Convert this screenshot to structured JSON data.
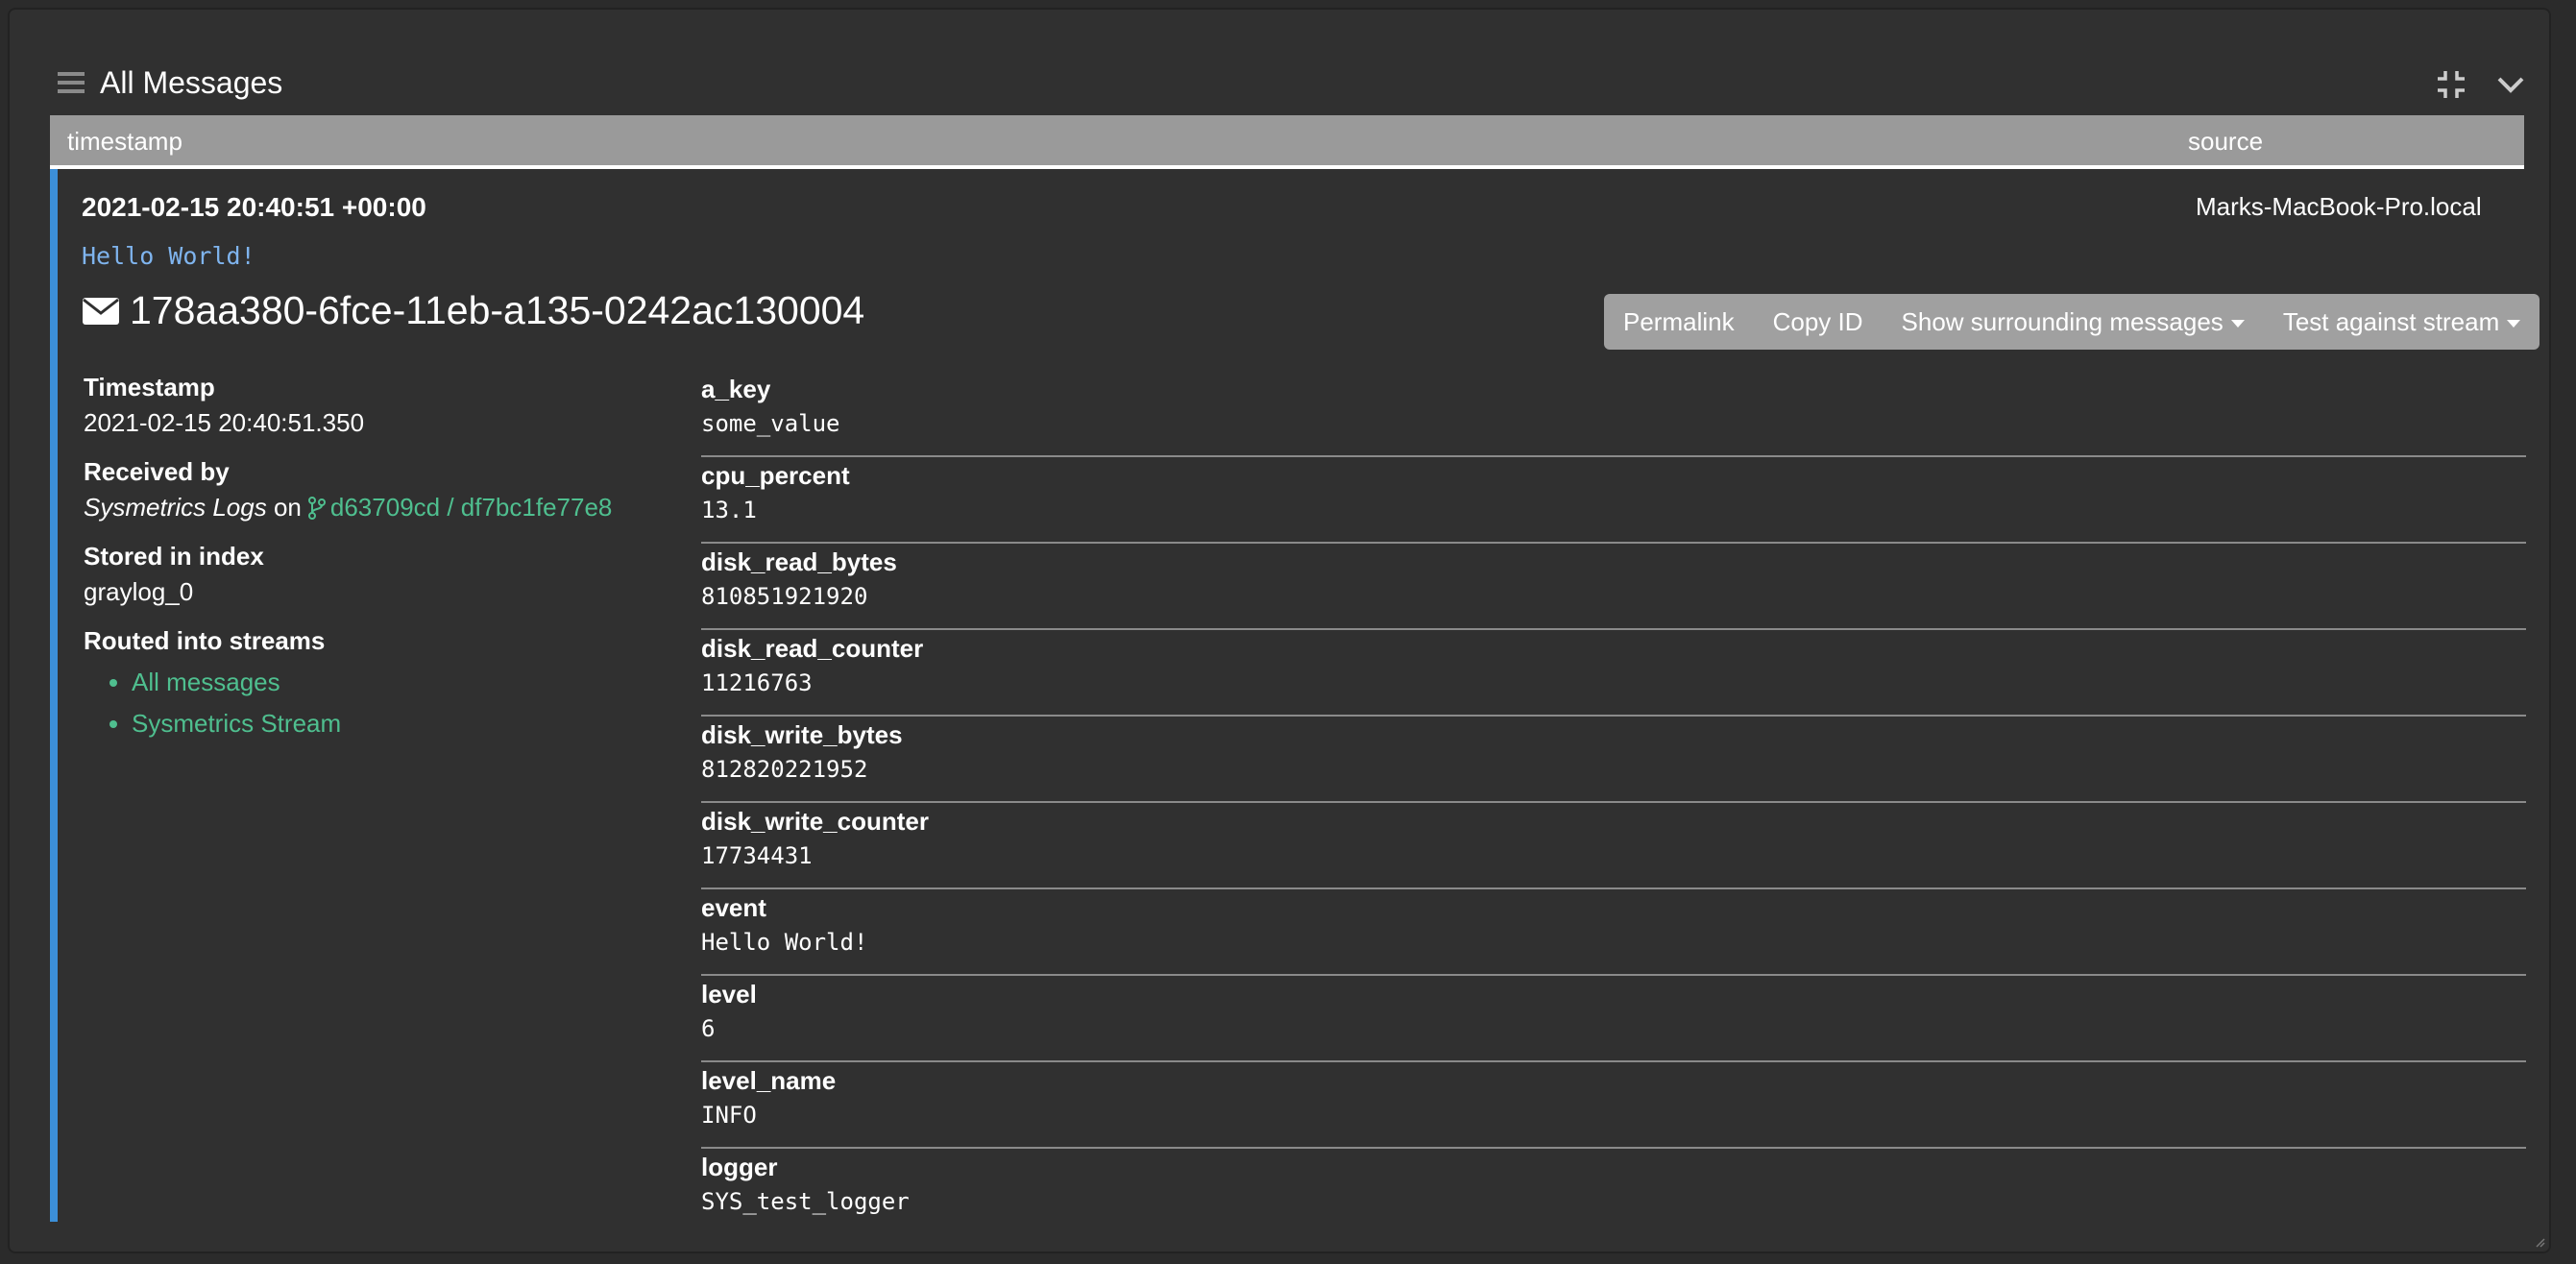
{
  "widget": {
    "title": "All Messages",
    "icons": [
      "drag-handle-icon",
      "minimize-icon",
      "chevron-down-icon"
    ]
  },
  "table": {
    "columns": [
      "timestamp",
      "source"
    ]
  },
  "message": {
    "timestamp": "2021-02-15 20:40:51 +00:00",
    "source": "Marks-MacBook-Pro.local",
    "text": "Hello World!",
    "id": "178aa380-6fce-11eb-a135-0242ac130004",
    "actions": {
      "permalink": "Permalink",
      "copy_id": "Copy ID",
      "surrounding": "Show surrounding messages",
      "test_stream": "Test against stream"
    },
    "meta": {
      "timestamp_label": "Timestamp",
      "timestamp_value": "2021-02-15 20:40:51.350",
      "received_label": "Received by",
      "received_input": "Sysmetrics Logs",
      "received_on": "on",
      "received_node": "d63709cd / df7bc1fe77e8",
      "index_label": "Stored in index",
      "index_value": "graylog_0",
      "streams_label": "Routed into streams",
      "streams": [
        "All messages",
        "Sysmetrics Stream"
      ]
    },
    "fields": [
      {
        "name": "a_key",
        "value": "some_value"
      },
      {
        "name": "cpu_percent",
        "value": "13.1"
      },
      {
        "name": "disk_read_bytes",
        "value": "810851921920"
      },
      {
        "name": "disk_read_counter",
        "value": "11216763"
      },
      {
        "name": "disk_write_bytes",
        "value": "812820221952"
      },
      {
        "name": "disk_write_counter",
        "value": "17734431"
      },
      {
        "name": "event",
        "value": "Hello World!"
      },
      {
        "name": "level",
        "value": "6"
      },
      {
        "name": "level_name",
        "value": "INFO"
      },
      {
        "name": "logger",
        "value": "SYS_test_logger"
      }
    ]
  },
  "colors": {
    "accent_bar": "#3c8fd8",
    "link": "#4fbf8f",
    "message_text": "#7fb4ee",
    "header_bg": "#9a9a9a"
  }
}
